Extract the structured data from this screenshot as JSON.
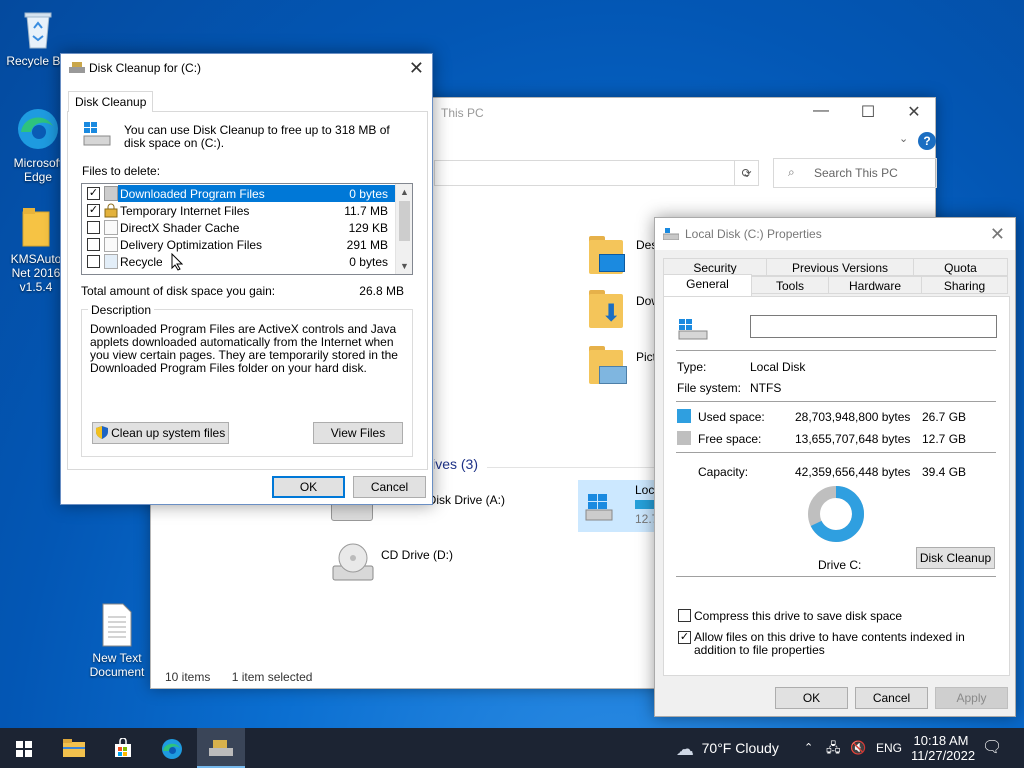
{
  "desktop": {
    "icons": [
      {
        "label": "Recycle Bin"
      },
      {
        "label": "Microsoft Edge"
      },
      {
        "label": "KMSAuto Net 2016 v1.5.4"
      },
      {
        "label": "New Text Document"
      }
    ]
  },
  "explorer": {
    "title": "This PC",
    "search_placeholder": "Search This PC",
    "folders": [
      "Desktop",
      "Downloads",
      "Pictures"
    ],
    "section": "Devices and drives (3)",
    "drives": [
      "Floppy Disk Drive (A:)",
      "CD Drive (D:)",
      "Local Disk (C:)"
    ],
    "drive_c_free_short": "12.7",
    "status_items": "10 items",
    "status_selected": "1 item selected"
  },
  "cleanup": {
    "title": "Disk Cleanup for  (C:)",
    "tab": "Disk Cleanup",
    "intro": "You can use Disk Cleanup to free up to 318 MB of disk space on  (C:).",
    "files_label": "Files to delete:",
    "files": [
      {
        "name": "Downloaded Program Files",
        "size": "0 bytes",
        "checked": true,
        "selected": true
      },
      {
        "name": "Temporary Internet Files",
        "size": "11.7 MB",
        "checked": true,
        "selected": false
      },
      {
        "name": "DirectX Shader Cache",
        "size": "129 KB",
        "checked": false,
        "selected": false
      },
      {
        "name": "Delivery Optimization Files",
        "size": "291 MB",
        "checked": false,
        "selected": false
      },
      {
        "name": "Recycle Bin",
        "size": "0 bytes",
        "checked": false,
        "selected": false
      }
    ],
    "total_label": "Total amount of disk space you gain:",
    "total_value": "26.8 MB",
    "desc_label": "Description",
    "description": "Downloaded Program Files are ActiveX controls and Java applets downloaded automatically from the Internet when you view certain pages. They are temporarily stored in the Downloaded Program Files folder on your hard disk.",
    "cleanup_system": "Clean up system files",
    "view_files": "View Files",
    "ok": "OK",
    "cancel": "Cancel"
  },
  "props": {
    "title": "Local Disk (C:) Properties",
    "tabs_row1": [
      "Security",
      "Previous Versions",
      "Quota"
    ],
    "tabs_row2": [
      "General",
      "Tools",
      "Hardware",
      "Sharing"
    ],
    "type_label": "Type:",
    "type_value": "Local Disk",
    "fs_label": "File system:",
    "fs_value": "NTFS",
    "used_label": "Used space:",
    "used_bytes": "28,703,948,800 bytes",
    "used_gb": "26.7 GB",
    "free_label": "Free space:",
    "free_bytes": "13,655,707,648 bytes",
    "free_gb": "12.7 GB",
    "cap_label": "Capacity:",
    "cap_bytes": "42,359,656,448 bytes",
    "cap_gb": "39.4 GB",
    "drive_label": "Drive C:",
    "disk_cleanup": "Disk Cleanup",
    "compress": "Compress this drive to save disk space",
    "index": "Allow files on this drive to have contents indexed in addition to file properties",
    "compress_checked": false,
    "index_checked": true,
    "ok": "OK",
    "cancel": "Cancel",
    "apply": "Apply",
    "used_fraction": 0.678,
    "colors": {
      "used": "#2f9fe0",
      "free": "#bfbfbf"
    }
  },
  "taskbar": {
    "weather": "70°F  Cloudy",
    "lang": "ENG",
    "time": "10:18 AM",
    "date": "11/27/2022"
  }
}
